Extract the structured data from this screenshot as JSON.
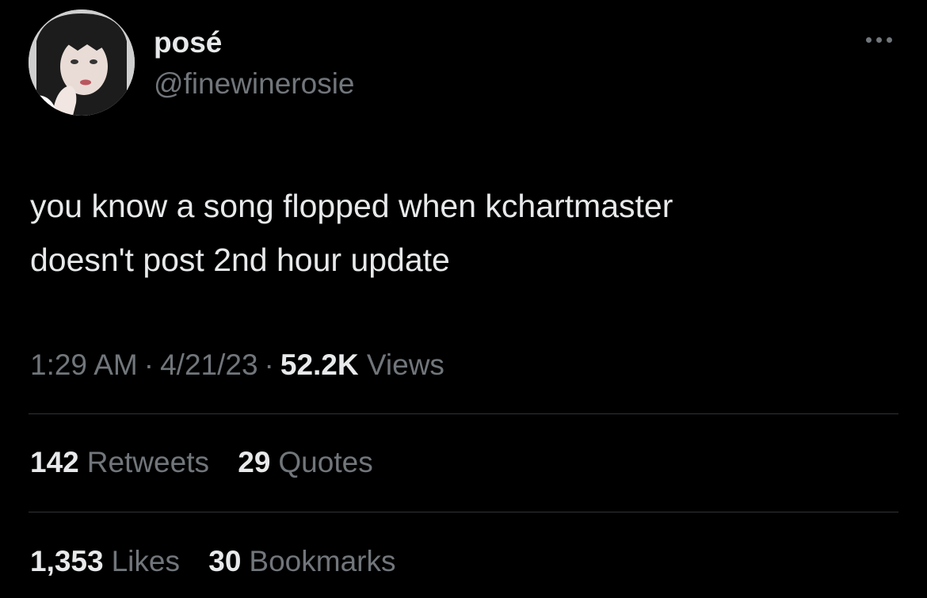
{
  "user": {
    "display_name": "posé",
    "handle": "@finewinerosie"
  },
  "tweet": {
    "text_lines": [
      "you know a song flopped when kchartmaster",
      "doesn't post 2nd hour update"
    ],
    "time": "1:29 AM",
    "date": "4/21/23",
    "views_count": "52.2K",
    "views_label": "Views",
    "separator": "·"
  },
  "stats": {
    "retweets_count": "142",
    "retweets_label": "Retweets",
    "quotes_count": "29",
    "quotes_label": "Quotes",
    "likes_count": "1,353",
    "likes_label": "Likes",
    "bookmarks_count": "30",
    "bookmarks_label": "Bookmarks"
  },
  "icons": {
    "more": "more-horizontal-icon",
    "avatar": "profile-avatar"
  },
  "colors": {
    "background": "#000000",
    "primary_text": "#e7e9ea",
    "secondary_text": "#71767b",
    "divider": "#2f3336"
  }
}
